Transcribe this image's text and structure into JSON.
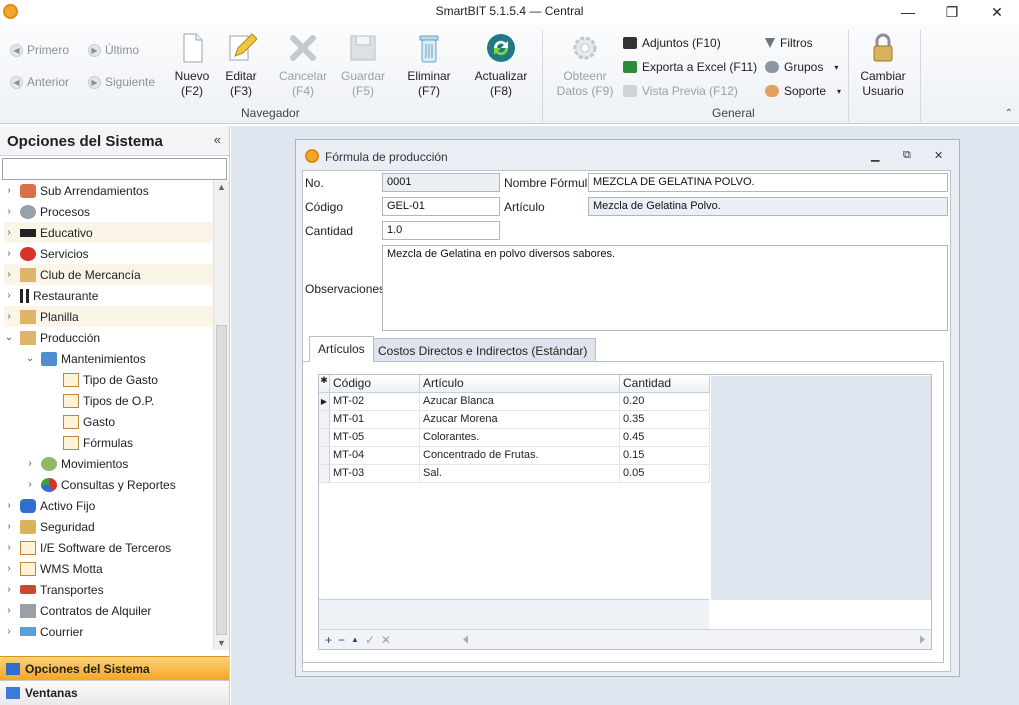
{
  "window": {
    "title": "SmartBIT 5.1.5.4 — Central",
    "minimize": "—",
    "maximize": "❐",
    "close": "✕"
  },
  "ribbon": {
    "nav_small": {
      "primero": "Primero",
      "ultimo": "Último",
      "anterior": "Anterior",
      "siguiente": "Siguiente"
    },
    "buttons": {
      "nuevo": "Nuevo\n(F2)",
      "editar": "Editar\n(F3)",
      "cancelar": "Cancelar\n(F4)",
      "guardar": "Guardar\n(F5)",
      "eliminar": "Eliminar\n(F7)",
      "actualizar": "Actualizar\n(F8)",
      "obtener": "Obteenr\nDatos (F9)",
      "cambiar": "Cambiar\nUsuario"
    },
    "groups": {
      "navegador": "Navegador",
      "general": "General"
    },
    "small": {
      "adjuntos": "Adjuntos (F10)",
      "exporta": "Exporta a Excel (F11)",
      "vista": "Vista Previa (F12)",
      "filtros": "Filtros",
      "grupos": "Grupos",
      "soporte": "Soporte"
    }
  },
  "sidebar": {
    "title": "Opciones del Sistema",
    "collapse": "«",
    "search_value": "",
    "items": [
      {
        "label": "Sub Arrendamientos",
        "exp": "›"
      },
      {
        "label": "Procesos",
        "exp": "›"
      },
      {
        "label": "Educativo",
        "exp": "›"
      },
      {
        "label": "Servicios",
        "exp": "›"
      },
      {
        "label": "Club de Mercancía",
        "exp": "›"
      },
      {
        "label": "Restaurante",
        "exp": "›"
      },
      {
        "label": "Planilla",
        "exp": "›"
      },
      {
        "label": "Producción",
        "exp": "⌄"
      },
      {
        "label": "Mantenimientos",
        "exp": "⌄"
      },
      {
        "label": "Tipo de Gasto",
        "exp": ""
      },
      {
        "label": "Tipos de O.P.",
        "exp": ""
      },
      {
        "label": "Gasto",
        "exp": ""
      },
      {
        "label": "Fórmulas",
        "exp": ""
      },
      {
        "label": "Movimientos",
        "exp": "›"
      },
      {
        "label": "Consultas y Reportes",
        "exp": "›"
      },
      {
        "label": "Activo Fijo",
        "exp": "›"
      },
      {
        "label": "Seguridad",
        "exp": "›"
      },
      {
        "label": "I/E Software de Terceros",
        "exp": "›"
      },
      {
        "label": "WMS Motta",
        "exp": "›"
      },
      {
        "label": "Transportes",
        "exp": "›"
      },
      {
        "label": "Contratos de Alquiler",
        "exp": "›"
      },
      {
        "label": "Courrier",
        "exp": "›"
      }
    ],
    "nav_options": "Opciones del Sistema",
    "nav_windows": "Ventanas"
  },
  "form": {
    "title": "Fórmula de producción",
    "labels": {
      "no": "No.",
      "nombre": "Nombre Fórmula",
      "codigo": "Código",
      "articulo": "Artículo",
      "cantidad": "Cantidad",
      "observaciones": "Observaciones"
    },
    "values": {
      "no": "0001",
      "nombre": "MEZCLA DE GELATINA POLVO.",
      "codigo": "GEL-01",
      "articulo": "Mezcla de Gelatina Polvo.",
      "cantidad": "1.0",
      "observaciones": "Mezcla de Gelatina en polvo diversos sabores."
    },
    "tabs": [
      "Artículos",
      "Costos Directos e Indirectos (Estándar)"
    ],
    "grid": {
      "headers": [
        "Código",
        "Artículo",
        "Cantidad"
      ],
      "rows": [
        [
          "MT-02",
          "Azucar Blanca",
          "0.20"
        ],
        [
          "MT-01",
          "Azucar Morena",
          "0.35"
        ],
        [
          "MT-05",
          "Colorantes.",
          "0.45"
        ],
        [
          "MT-04",
          "Concentrado de Frutas.",
          "0.15"
        ],
        [
          "MT-03",
          "Sal.",
          "0.05"
        ]
      ]
    }
  },
  "colors": {
    "accent": "#f5a623",
    "workspace": "#dfe6ef"
  }
}
